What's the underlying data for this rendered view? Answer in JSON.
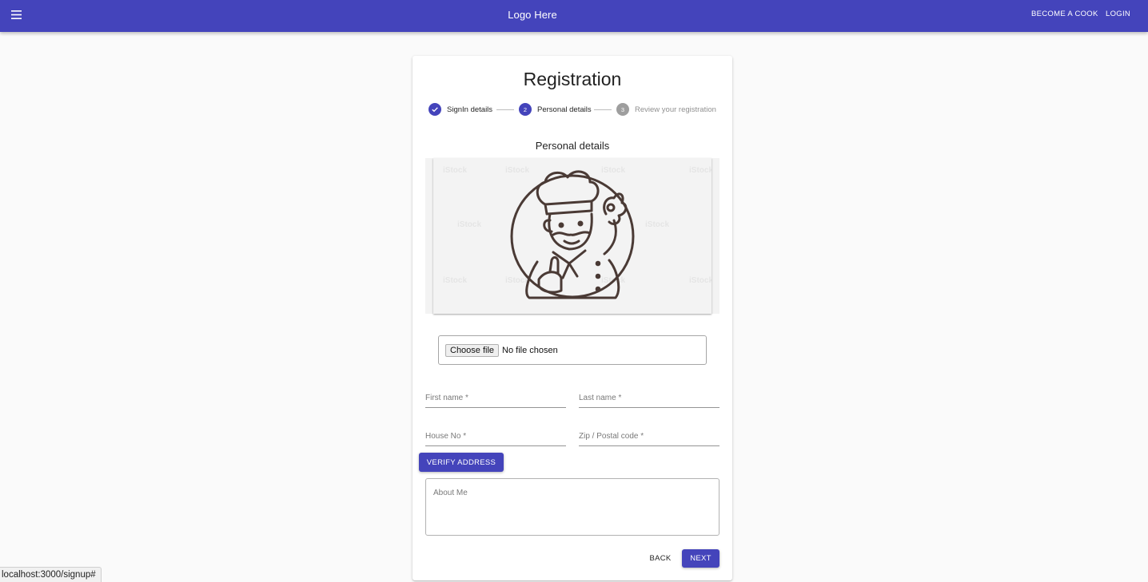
{
  "header": {
    "logo_text": "Logo Here",
    "become_cook_label": "BECOME A COOK",
    "login_label": "LOGIN",
    "accent_color": "#4444bb"
  },
  "registration": {
    "title": "Registration",
    "steps": [
      {
        "number": "1",
        "label": "SignIn details",
        "status": "completed"
      },
      {
        "number": "2",
        "label": "Personal details",
        "status": "active"
      },
      {
        "number": "3",
        "label": "Review your registration",
        "status": "inactive"
      }
    ],
    "section_title": "Personal details",
    "image_alt": "chef mascot illustration",
    "file_input": {
      "button_label": "Choose file",
      "status_text": "No file chosen"
    },
    "fields": {
      "first_name": "First name *",
      "last_name": "Last name *",
      "house_no": "House No *",
      "zip_code": "Zip / Postal code *"
    },
    "verify_address_label": "VERIFY ADDRESS",
    "about_me_placeholder": "About Me",
    "back_label": "BACK",
    "next_label": "NEXT"
  },
  "browser": {
    "status_url": "localhost:3000/signup#"
  }
}
